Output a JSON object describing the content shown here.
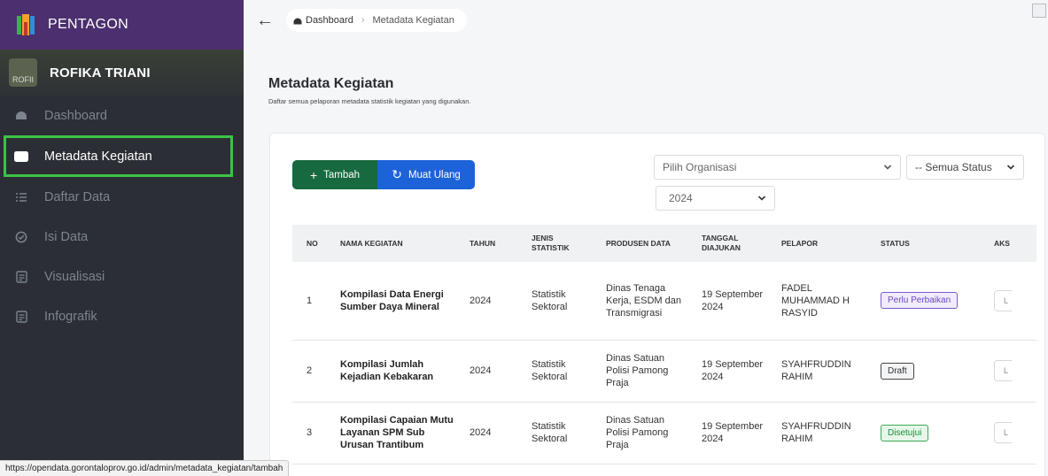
{
  "brand": {
    "name": "PENTAGON"
  },
  "user": {
    "name": "ROFIKA TRIANI",
    "avatar_alt": "ROFII"
  },
  "sidebar": {
    "items": [
      {
        "label": "Dashboard",
        "icon": "dashboard-icon",
        "active": false
      },
      {
        "label": "Metadata Kegiatan",
        "icon": "markdown-icon",
        "active": true
      },
      {
        "label": "Daftar Data",
        "icon": "list-icon",
        "active": false
      },
      {
        "label": "Isi Data",
        "icon": "check-circle-icon",
        "active": false
      },
      {
        "label": "Visualisasi",
        "icon": "document-icon",
        "active": false
      },
      {
        "label": "Infografik",
        "icon": "document-icon",
        "active": false
      }
    ]
  },
  "breadcrumb": {
    "home": "Dashboard",
    "current": "Metadata Kegiatan"
  },
  "page": {
    "title": "Metadata Kegiatan",
    "subtitle": "Daftar semua pelaporan metadata statistik kegiatan yang digunakan."
  },
  "toolbar": {
    "add_label": "Tambah",
    "reload_label": "Muat Ulang"
  },
  "filters": {
    "organisasi": "Pilih Organisasi",
    "status": "-- Semua Status",
    "year": "2024"
  },
  "table": {
    "headers": {
      "no": "NO",
      "nama": "NAMA KEGIATAN",
      "tahun": "TAHUN",
      "jenis": "JENIS STATISTIK",
      "produsen": "PRODUSEN DATA",
      "tanggal": "TANGGAL DIAJUKAN",
      "pelapor": "PELAPOR",
      "status": "STATUS",
      "aksi": "AKS"
    },
    "rows": [
      {
        "no": "1",
        "nama": "Kompilasi Data Energi Sumber Daya Mineral",
        "tahun": "2024",
        "jenis": "Statistik Sektoral",
        "produsen": "Dinas Tenaga Kerja, ESDM dan Transmigrasi",
        "tanggal": "19 September 2024",
        "pelapor": "FADEL MUHAMMAD H RASYID",
        "status": "Perlu Perbaikan",
        "aksi": "L"
      },
      {
        "no": "2",
        "nama": "Kompilasi Jumlah Kejadian Kebakaran",
        "tahun": "2024",
        "jenis": "Statistik Sektoral",
        "produsen": "Dinas Satuan Polisi Pamong Praja",
        "tanggal": "19 September 2024",
        "pelapor": "SYAHFRUDDIN RAHIM",
        "status": "Draft",
        "aksi": "L"
      },
      {
        "no": "3",
        "nama": "Kompilasi Capaian Mutu Layanan SPM Sub Urusan Trantibum",
        "tahun": "2024",
        "jenis": "Statistik Sektoral",
        "produsen": "Dinas Satuan Polisi Pamong Praja",
        "tanggal": "19 September 2024",
        "pelapor": "SYAHFRUDDIN RAHIM",
        "status": "Disetujui",
        "aksi": "L"
      }
    ]
  },
  "statusbar": {
    "url": "https://opendata.gorontaloprov.go.id/admin/metadata_kegiatan/tambah"
  },
  "colors": {
    "brand": "#4b2f6e",
    "sidebar": "#2b2f35",
    "active_border": "#3cc346",
    "add_button": "#17693f",
    "reload_button": "#1c62d8"
  }
}
